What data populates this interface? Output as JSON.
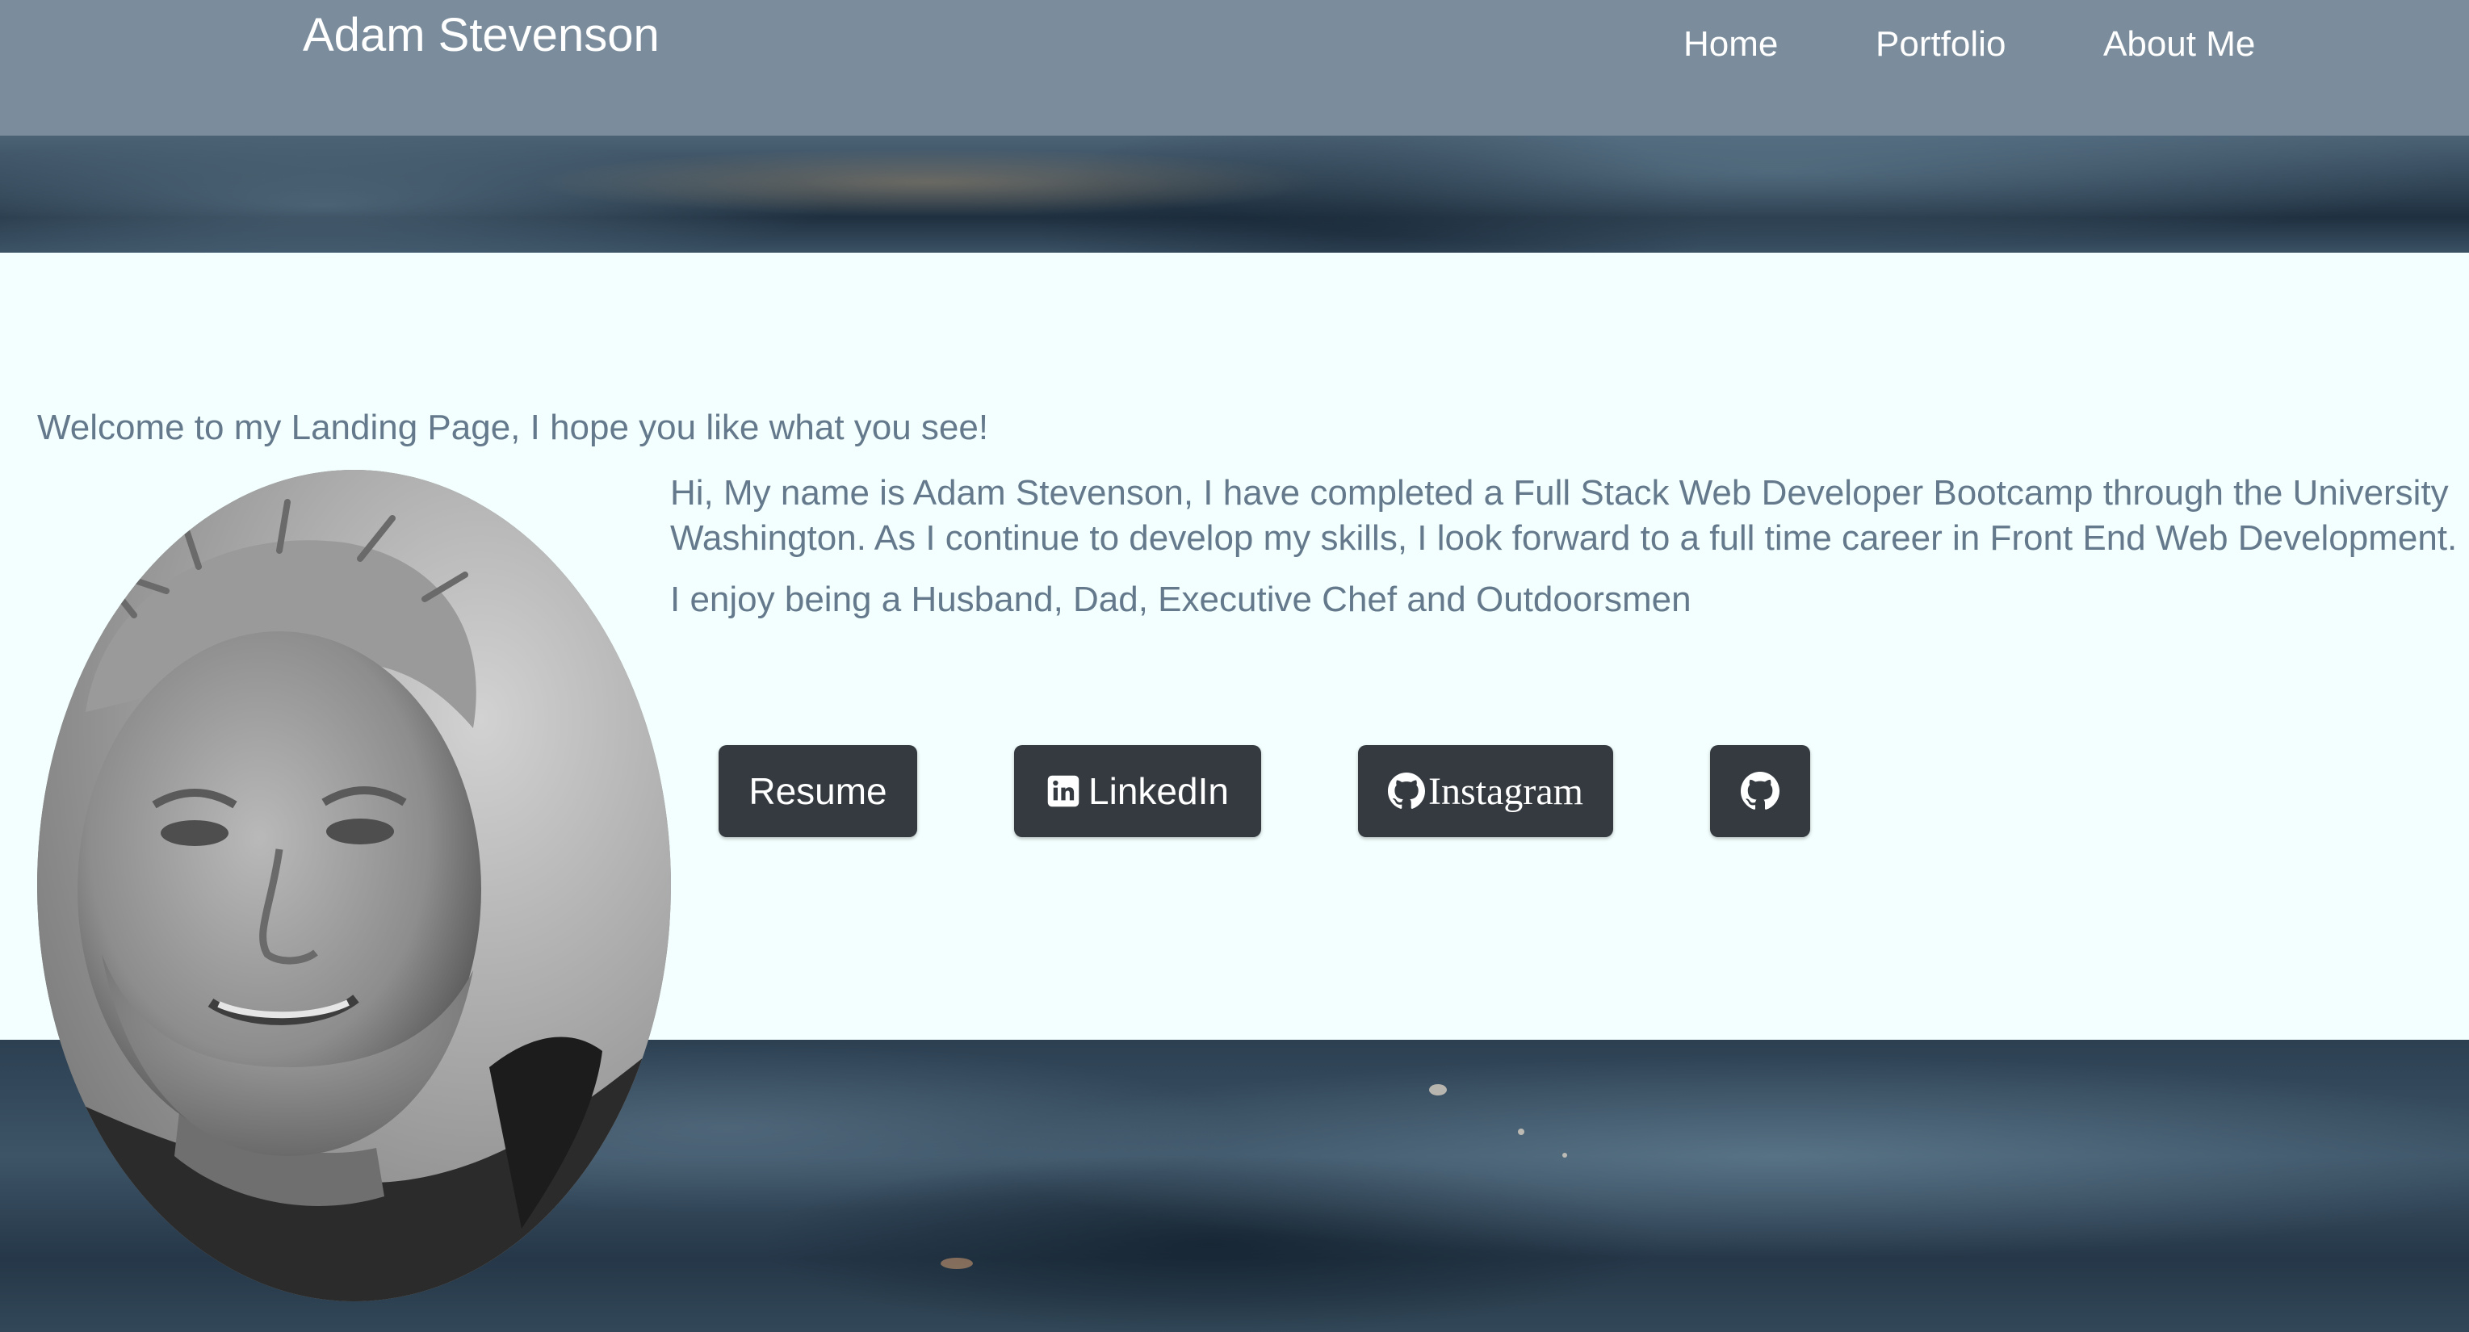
{
  "header": {
    "brand": "Adam Stevenson",
    "nav": [
      {
        "label": "Home"
      },
      {
        "label": "Portfolio"
      },
      {
        "label": "About Me"
      }
    ]
  },
  "main": {
    "welcome": "Welcome to my Landing Page, I hope you like what you see!",
    "bio_line_1": "Hi, My name is Adam Stevenson, I have completed a Full Stack Web Developer Bootcamp through the University",
    "bio_line_2": "Washington. As I continue to develop my skills, I look forward to a full time career in Front End Web Development.",
    "bio_line_3": "I enjoy being a Husband, Dad, Executive Chef and Outdoorsmen"
  },
  "buttons": {
    "resume": "Resume",
    "linkedin": "LinkedIn",
    "instagram": "Instagram",
    "github_icon": "github-icon"
  },
  "colors": {
    "header_bg": "#7b8d9c",
    "content_bg": "#f3fffe",
    "text": "#647a8c",
    "button_bg": "#343a40"
  }
}
